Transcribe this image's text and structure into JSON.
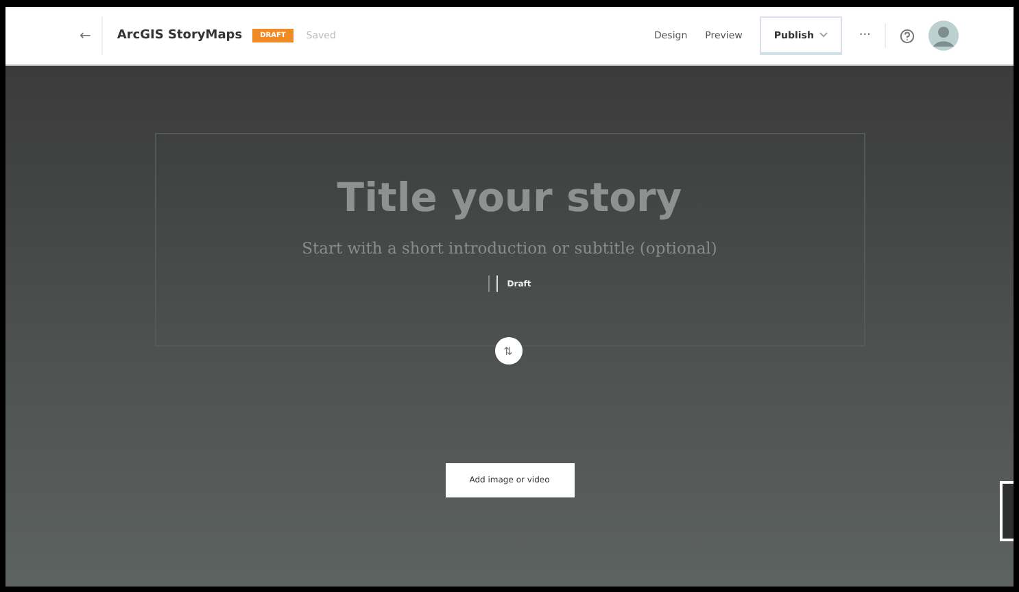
{
  "header": {
    "back": "←",
    "brand": "ArcGIS StoryMaps",
    "badge": "DRAFT",
    "save_status": "Saved",
    "nav": [
      {
        "label": "Design",
        "kind": "link"
      },
      {
        "label": "Preview",
        "kind": "link"
      },
      {
        "label": "Publish",
        "kind": "dropdown"
      },
      {
        "label": "···",
        "kind": "more"
      }
    ]
  },
  "story": {
    "title_placeholder": "Title your story",
    "subtitle_placeholder": "Start with a short introduction or subtitle (optional)",
    "byline": "Draft",
    "swap": "⇅",
    "add_media": "Add image or video"
  }
}
